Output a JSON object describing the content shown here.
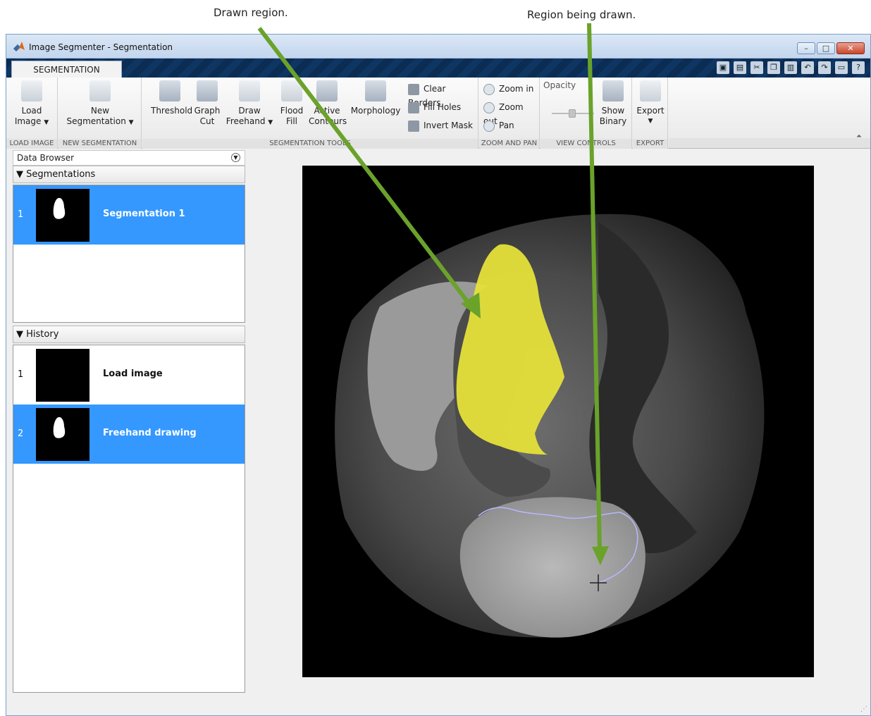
{
  "annotations": {
    "drawn_region": "Drawn region.",
    "region_being_drawn": "Region being drawn."
  },
  "window": {
    "title": "Image Segmenter - Segmentation",
    "tab": "SEGMENTATION"
  },
  "ribbon": {
    "load_image": {
      "line1": "Load",
      "line2": "Image",
      "group": "LOAD IMAGE"
    },
    "new_segmentation": {
      "line1": "New",
      "line2": "Segmentation",
      "group": "NEW SEGMENTATION"
    },
    "tools": {
      "threshold": "Threshold",
      "graph_cut": {
        "line1": "Graph",
        "line2": "Cut"
      },
      "draw_freehand": {
        "line1": "Draw",
        "line2": "Freehand"
      },
      "flood_fill": {
        "line1": "Flood",
        "line2": "Fill"
      },
      "active_contours": {
        "line1": "Active",
        "line2": "Contours"
      },
      "morphology": "Morphology",
      "clear_borders": "Clear Borders",
      "fill_holes": "Fill Holes",
      "invert_mask": "Invert Mask",
      "group": "SEGMENTATION TOOLS"
    },
    "zoom": {
      "zoom_in": "Zoom in",
      "zoom_out": "Zoom out",
      "pan": "Pan",
      "group": "ZOOM AND PAN"
    },
    "view": {
      "opacity": "Opacity",
      "show_binary": {
        "line1": "Show",
        "line2": "Binary"
      },
      "group": "VIEW CONTROLS"
    },
    "export": {
      "label": "Export",
      "group": "EXPORT"
    }
  },
  "data_browser": {
    "title": "Data Browser",
    "segmentations_header": "Segmentations",
    "segmentations": [
      {
        "num": "1",
        "label": "Segmentation 1"
      }
    ],
    "history_header": "History",
    "history": [
      {
        "num": "1",
        "label": "Load image"
      },
      {
        "num": "2",
        "label": "Freehand drawing"
      }
    ]
  },
  "colors": {
    "selection": "#3498ff",
    "overlay": "#e5e03a",
    "annotation_arrow": "#6aa22a",
    "tabstrip": "#0c2f58"
  }
}
